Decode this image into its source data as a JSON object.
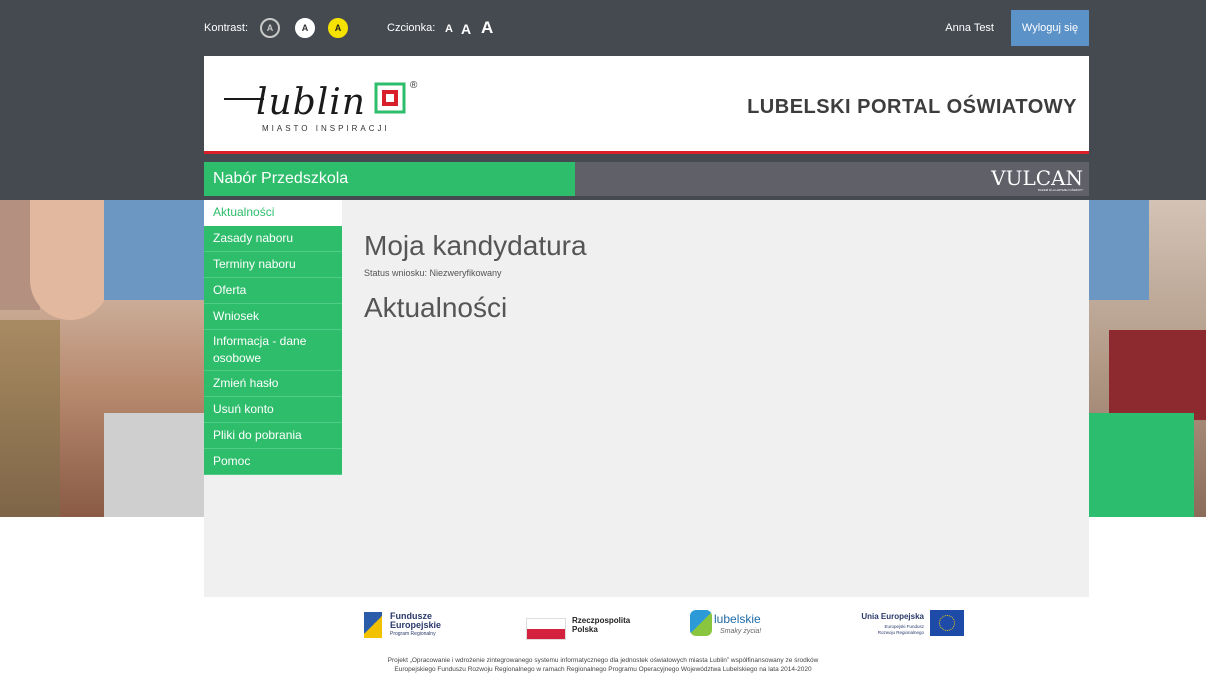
{
  "util": {
    "contrast_label": "Kontrast:",
    "contrast_options": [
      "A",
      "A",
      "A"
    ],
    "font_label": "Czcionka:",
    "font_options": [
      "A",
      "A",
      "A"
    ],
    "user_name": "Anna Test",
    "logout_label": "Wyloguj się"
  },
  "header": {
    "logo_word": "lublin",
    "logo_tagline": "MIASTO INSPIRACJI",
    "logo_registered": "®",
    "portal_title": "LUBELSKI PORTAL OŚWIATOWY"
  },
  "nav": {
    "section_title": "Nabór Przedszkola",
    "vulcan_logo": "VULCAN",
    "vulcan_tagline": "RAZEM DLA LEPSZEJ OŚWIATY"
  },
  "menu": {
    "items": [
      {
        "label": "Aktualności",
        "active": true
      },
      {
        "label": "Zasady naboru"
      },
      {
        "label": "Terminy naboru"
      },
      {
        "label": "Oferta"
      },
      {
        "label": "Wniosek"
      },
      {
        "label": "Informacja - dane osobowe"
      },
      {
        "label": "Zmień hasło"
      },
      {
        "label": "Usuń konto"
      },
      {
        "label": "Pliki do pobrania"
      },
      {
        "label": "Pomoc"
      }
    ]
  },
  "main": {
    "title": "Moja kandydatura",
    "status": "Status wniosku: Niezweryfikowany",
    "news_title": "Aktualności"
  },
  "footer": {
    "logos": {
      "fundusze_line1": "Fundusze",
      "fundusze_line2": "Europejskie",
      "fundusze_sub": "Program Regionalny",
      "rp_line1": "Rzeczpospolita",
      "rp_line2": "Polska",
      "lubelskie": "lubelskie",
      "lubelskie_sub": "Smaky życia!",
      "ue_title": "Unia Europejska",
      "ue_sub1": "Europejski Fundusz",
      "ue_sub2": "Rozwoju Regionalnego"
    },
    "text_line1": "Projekt „Opracowanie i wdrożenie zintegrowanego systemu informatycznego dla jednostek oświatowych miasta Lublin” współfinansowany ze środków",
    "text_line2": "Europejskiego Funduszu Rozwoju Regionalnego w ramach Regionalnego Programu Operacyjnego Województwa Lubelskiego na lata 2014-2020"
  },
  "colors": {
    "accent_green": "#2ebd6b",
    "header_red": "#d81f2a",
    "dark_band": "#454a51",
    "logout_blue": "#5b92c8"
  }
}
